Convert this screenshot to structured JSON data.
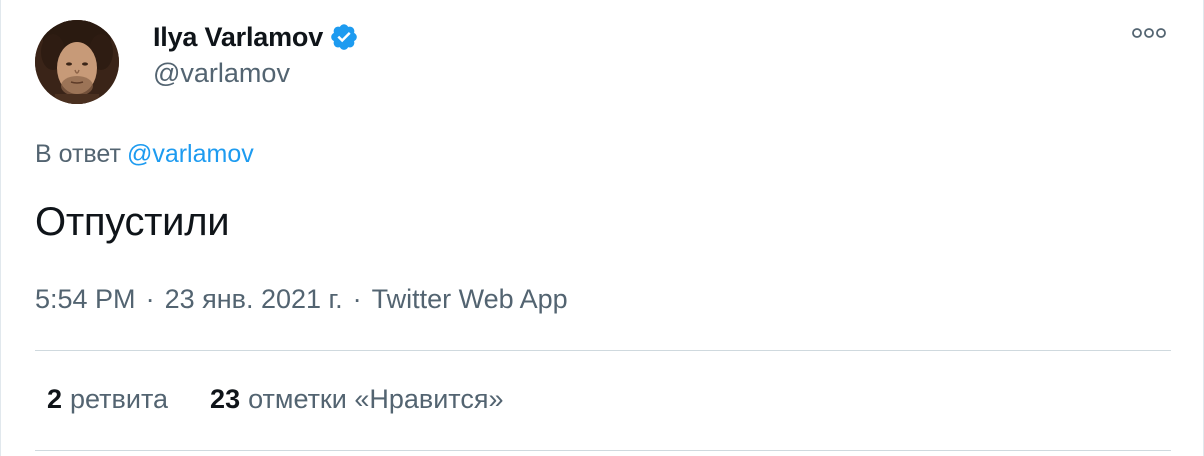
{
  "author": {
    "display_name": "Ilya Varlamov",
    "handle": "@varlamov",
    "verified": true,
    "avatar_icon": "user-avatar"
  },
  "header": {
    "more_icon": "more-options-icon"
  },
  "tweet": {
    "reply_prefix": "В ответ",
    "reply_to": "@varlamov",
    "text": "Отпустили",
    "time": "5:54 PM",
    "date": "23 янв. 2021 г.",
    "source": "Twitter Web App",
    "separator": "·"
  },
  "stats": {
    "retweets_count": "2",
    "retweets_label": "ретвита",
    "likes_count": "23",
    "likes_label": "отметки «Нравится»"
  },
  "colors": {
    "accent": "#1d9bf0",
    "text_primary": "#0f1419",
    "text_secondary": "#536471",
    "divider": "#cfd9de"
  }
}
